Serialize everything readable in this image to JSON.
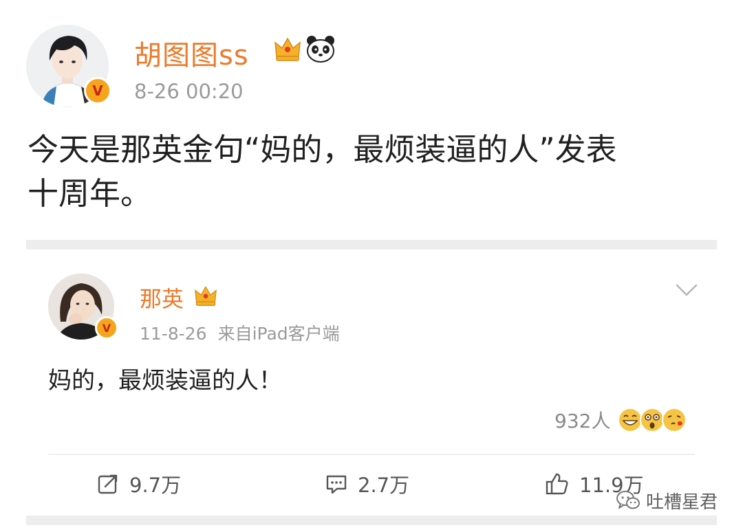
{
  "post": {
    "username": "胡图图ss",
    "timestamp": "8-26 00:20",
    "text_line1": "今天是那英金句“妈的，最烦装逼的人”发表",
    "text_line2": "十周年。"
  },
  "retweet": {
    "username": "那英",
    "date": "11-8-26",
    "source": "来自iPad客户端",
    "text": "妈的，最烦装逼的人！",
    "reaction_count": "932人"
  },
  "actions": {
    "repost": "9.7万",
    "comment": "2.7万",
    "like": "11.9万"
  },
  "watermark": "吐槽星君",
  "colors": {
    "username": "#ec7a2a",
    "verified_badge": "#f7a51c",
    "muted_text": "#9a9a9a"
  },
  "icons": [
    "verified-badge-icon",
    "crown-icon",
    "panda-icon",
    "chevron-down-icon",
    "repost-icon",
    "comment-icon",
    "like-icon",
    "wechat-icon",
    "laugh-emoji-icon",
    "surprised-emoji-icon",
    "kiss-emoji-icon"
  ]
}
